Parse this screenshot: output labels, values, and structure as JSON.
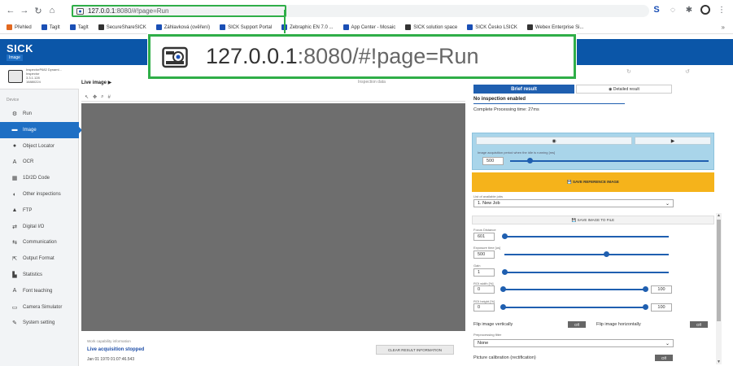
{
  "browser": {
    "url_host": "127.0.0.1",
    "url_rest": ":8080/#!page=Run",
    "bookmarks": [
      {
        "label": "Přehled",
        "color": "#e2681f"
      },
      {
        "label": "TagIt",
        "color": "#1a4fb5"
      },
      {
        "label": "TagIt",
        "color": "#1a4fb5"
      },
      {
        "label": "SecureShareSICK",
        "color": "#333333"
      },
      {
        "label": "Záhlavková (ověření)",
        "color": "#1a4fb5"
      },
      {
        "label": "SICK Support Portal",
        "color": "#1a4fb5"
      },
      {
        "label": "Zebraphic EN 7.0 ...",
        "color": "#1a4fb5"
      },
      {
        "label": "App Center - Mosaic",
        "color": "#1a4fb5"
      },
      {
        "label": "SICK solution space",
        "color": "#333333"
      },
      {
        "label": "SICK Česko LSICK",
        "color": "#1a4fb5"
      },
      {
        "label": "Webex Enterprise Si...",
        "color": "#333333"
      }
    ],
    "more": "»"
  },
  "app": {
    "logo": "SICK",
    "subtitle": "Image"
  },
  "callout": {
    "url_host": "127.0.0.1",
    "url_rest": ":8080/#!page=Run"
  },
  "device": {
    "name": "InspectorP682 Dynami...",
    "line2": "Inspector",
    "line3": "3.3.1.128",
    "line4": "16880224"
  },
  "sidebar": {
    "section": "Device",
    "items": [
      {
        "label": "Run",
        "icon": "⚙"
      },
      {
        "label": "Image",
        "icon": "▬"
      },
      {
        "label": "Object Locator",
        "icon": "●"
      },
      {
        "label": "OCR",
        "icon": "A"
      },
      {
        "label": "1D/2D Code",
        "icon": "▦"
      },
      {
        "label": "Other inspections",
        "icon": "◐"
      },
      {
        "label": "FTP",
        "icon": "▲"
      },
      {
        "label": "Digital I/O",
        "icon": "⇄"
      },
      {
        "label": "Communication",
        "icon": "⇆"
      },
      {
        "label": "Output Format",
        "icon": "⇱"
      },
      {
        "label": "Statistics",
        "icon": "▙"
      },
      {
        "label": "Font teaching",
        "icon": "A"
      },
      {
        "label": "Camera Simulator",
        "icon": "▭"
      },
      {
        "label": "System setting",
        "icon": "✎"
      }
    ]
  },
  "center": {
    "live_title": "Live image ▶",
    "head_right": "Inspection data",
    "work_info": "Work capability information",
    "live_stopped": "Live acquisition stopped",
    "timestamp": "Jan 01 1970 01:07:46.543",
    "clear_btn": "CLEAR RESULT INFORMATION"
  },
  "right": {
    "top_icon_1": "↻",
    "top_icon_2": "↺",
    "brief_tab": "Brief result",
    "detail_tab": "◉ Detailed result",
    "no_inspection": "No inspection enabled",
    "proc_time": "Complete Processing time: 27ms",
    "cam_snap": "◉",
    "cam_play": "▶",
    "acq_label": "Image acquisition period when the idle is running [ms]",
    "acq_value": "500",
    "acq_fraction": 0.1,
    "save_reference": "💾 SAVE REFERENCE IMAGE",
    "jobs_label": "List of available jobs",
    "job_selected": "1. New Job",
    "save_file": "💾 SAVE IMAGE TO FILE",
    "params": [
      {
        "label": "Focus Distance",
        "value": "601",
        "fraction": 0.0
      },
      {
        "label": "Exposure time [us]",
        "value": "500",
        "fraction": 0.62
      },
      {
        "label": "Gain",
        "value": "1",
        "fraction": 0.0
      }
    ],
    "roi": [
      {
        "label": "ROI width [%]",
        "min": "0",
        "max": "100"
      },
      {
        "label": "ROI height [%]",
        "min": "0",
        "max": "100"
      }
    ],
    "flip_v": "Flip image vertically",
    "flip_h": "Flip image horizontally",
    "toggle_off": "Off",
    "preproc_label": "Preprocessing filter",
    "preproc_selected": "None",
    "calib": "Picture calibration (rectification)",
    "accent": "#1f5fb0",
    "warn": "#f5b31b"
  }
}
